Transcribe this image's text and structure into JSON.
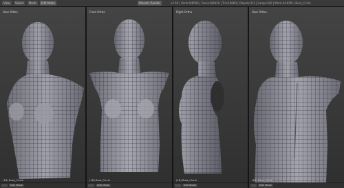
{
  "toolbar": {
    "view_btn": "View",
    "object_btn": "Select",
    "mesh_btn": "Mesh",
    "mode_select": "Edit Mode",
    "render_select": "Blender Render",
    "info_text": "v2.69 | Verts:0/8506 | Faces:0/8430 | Tris:16860 | Objects:1/1 | Lamps:0/0 | Mem:44.85M | Bust_Circle"
  },
  "viewports": [
    {
      "label": "User Ortho",
      "mode": "Edit Mode",
      "object": "(18) Bust_Circle"
    },
    {
      "label": "Front Ortho",
      "mode": "Edit Mode",
      "object": "(18) Bust_Circle"
    },
    {
      "label": "Right Ortho",
      "mode": "Edit Mode",
      "object": "(18) Bust_Circle"
    },
    {
      "label": "User Ortho",
      "mode": "Edit Mode",
      "object": "(18) Bust_Circle"
    }
  ],
  "colors": {
    "background": "#262626",
    "mesh_fill": "#8f8f9a",
    "mesh_wire": "#1e1e28",
    "viewport_bg": "#393939"
  }
}
